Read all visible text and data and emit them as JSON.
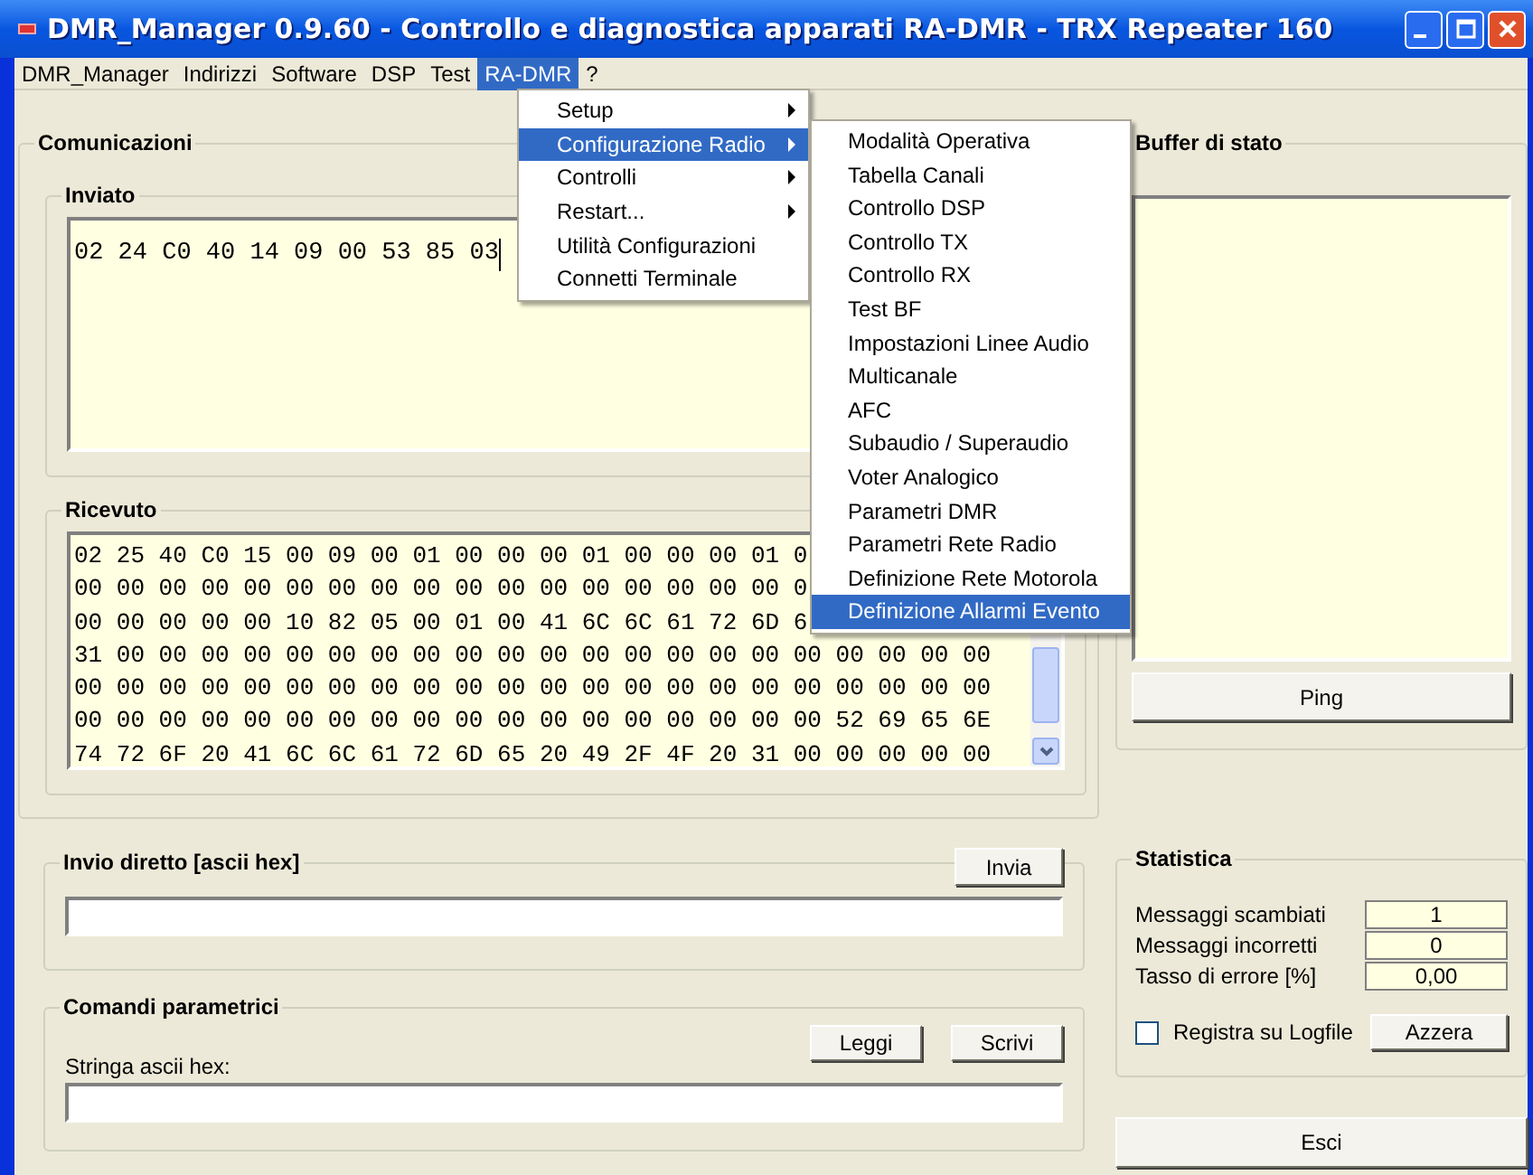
{
  "window": {
    "title": "DMR_Manager 0.9.60 - Controllo e diagnostica apparati RA-DMR - TRX Repeater 160"
  },
  "menu_bar": [
    {
      "label": "DMR_Manager",
      "selected": false
    },
    {
      "label": "Indirizzi",
      "selected": false
    },
    {
      "label": "Software",
      "selected": false
    },
    {
      "label": "DSP",
      "selected": false
    },
    {
      "label": "Test",
      "selected": false
    },
    {
      "label": "RA-DMR",
      "selected": true
    },
    {
      "label": "?",
      "selected": false
    }
  ],
  "open_menu": [
    {
      "label": "Setup",
      "submenu": true,
      "selected": false
    },
    {
      "label": "Configurazione Radio",
      "submenu": true,
      "selected": true
    },
    {
      "label": "Controlli",
      "submenu": true,
      "selected": false
    },
    {
      "label": "Restart...",
      "submenu": true,
      "selected": false
    },
    {
      "label": "Utilità Configurazioni",
      "submenu": false,
      "selected": false
    },
    {
      "label": "Connetti Terminale",
      "submenu": false,
      "selected": false
    }
  ],
  "submenu": [
    {
      "label": "Modalità Operativa",
      "selected": false
    },
    {
      "label": "Tabella Canali",
      "selected": false
    },
    {
      "label": "Controllo DSP",
      "selected": false
    },
    {
      "label": "Controllo TX",
      "selected": false
    },
    {
      "label": "Controllo RX",
      "selected": false
    },
    {
      "label": "Test BF",
      "selected": false
    },
    {
      "label": "Impostazioni Linee Audio",
      "selected": false
    },
    {
      "label": "Multicanale",
      "selected": false
    },
    {
      "label": "AFC",
      "selected": false
    },
    {
      "label": "Subaudio / Superaudio",
      "selected": false
    },
    {
      "label": "Voter Analogico",
      "selected": false
    },
    {
      "label": "Parametri DMR",
      "selected": false
    },
    {
      "label": "Parametri Rete Radio",
      "selected": false
    },
    {
      "label": "Definizione Rete Motorola",
      "selected": false
    },
    {
      "label": "Definizione Allarmi Evento",
      "selected": true
    }
  ],
  "comunicazioni": {
    "title": "Comunicazioni",
    "inviato": {
      "title": "Inviato",
      "lines": [
        "02 24 C0 40 14 09 00 53 85 03"
      ]
    },
    "ricevuto": {
      "title": "Ricevuto",
      "lines": [
        "02 25 40 C0 15 00 09 00 01 00 00 00 01 00 00 00 01 0",
        "00 00 00 00 00 00 00 00 00 00 00 00 00 00 00 00 00 0",
        "00 00 00 00 00 10 82 05 00 01 00 41 6C 6C 61 72 6D 6",
        "31 00 00 00 00 00 00 00 00 00 00 00 00 00 00 00 00 00 00 00 00 00",
        "00 00 00 00 00 00 00 00 00 00 00 00 00 00 00 00 00 00 00 00 00 00",
        "00 00 00 00 00 00 00 00 00 00 00 00 00 00 00 00 00 00 52 69 65 6E",
        "74 72 6F 20 41 6C 6C 61 72 6D 65 20 49 2F 4F 20 31 00 00 00 00 00"
      ]
    }
  },
  "invio_diretto": {
    "title": "Invio diretto [ascii hex]",
    "button": "Invia"
  },
  "comandi_parametrici": {
    "title": "Comandi parametrici",
    "buttons": [
      "Leggi",
      "Scrivi"
    ],
    "field_label": "Stringa ascii hex:"
  },
  "buffer_di_stato": {
    "title": "Buffer di stato",
    "button": "Ping"
  },
  "statistica": {
    "title": "Statistica",
    "rows": [
      {
        "label": "Messaggi scambiati",
        "value": "1"
      },
      {
        "label": "Messaggi incorretti",
        "value": "0"
      },
      {
        "label": "Tasso di errore [%]",
        "value": "0,00"
      }
    ],
    "checkbox": {
      "label": "Registra su Logfile",
      "checked": false
    },
    "button": "Azzera"
  },
  "exit_button": "Esci"
}
